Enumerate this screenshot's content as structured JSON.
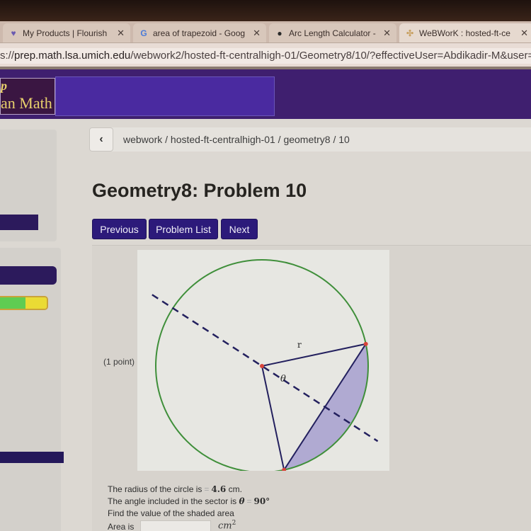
{
  "browser": {
    "tabs": [
      {
        "title": "My Products | Flourish",
        "icon": "flourish-icon",
        "close": "✕"
      },
      {
        "title": "area of trapezoid - Goog",
        "icon": "google-icon",
        "close": "✕"
      },
      {
        "title": "Arc Length Calculator - C",
        "icon": "calculator-site-icon",
        "close": "✕"
      },
      {
        "title": "WeBWorK : hosted-ft-ce",
        "icon": "webwork-icon",
        "close": "✕"
      }
    ],
    "url_prefix": "s://",
    "url_host": "prep.math.lsa.umich.edu",
    "url_path": "/webwork2/hosted-ft-centralhigh-01/Geometry8/10/?effectiveUser=Abdikadir-M&user=Abdikad"
  },
  "header": {
    "logo_mark": "p",
    "logo_text": "an Math"
  },
  "breadcrumb": {
    "back_label": "‹",
    "path": "webwork / hosted-ft-centralhigh-01 / geometry8 / 10"
  },
  "page_title": "Geometry8: Problem 10",
  "nav": {
    "previous": "Previous",
    "problem_list": "Problem List",
    "next": "Next"
  },
  "sidebar": {
    "progress": {
      "correct_fraction": 0.55,
      "partial_fraction": 0.45,
      "correct_color": "#5fcc52",
      "partial_color": "#eadb34"
    }
  },
  "problem": {
    "points": "(1 point)",
    "figure": {
      "radius_label": "r",
      "angle_label": "θ",
      "circle_color": "#3f8f3a",
      "line_color": "#23205e",
      "shade_color": "#9e95cc",
      "point_color": "#d9443a"
    },
    "line1_prefix": "The radius of the circle is",
    "line1_value": "4.6",
    "line1_unit": "cm.",
    "line2_prefix": "The angle included in the sector is",
    "line2_var": "θ",
    "line2_value": "90°",
    "line3": "Find the value of the shaded area",
    "answer_label": "Area is",
    "answer_value": "",
    "answer_unit": "cm",
    "answer_unit_exp": "2"
  }
}
